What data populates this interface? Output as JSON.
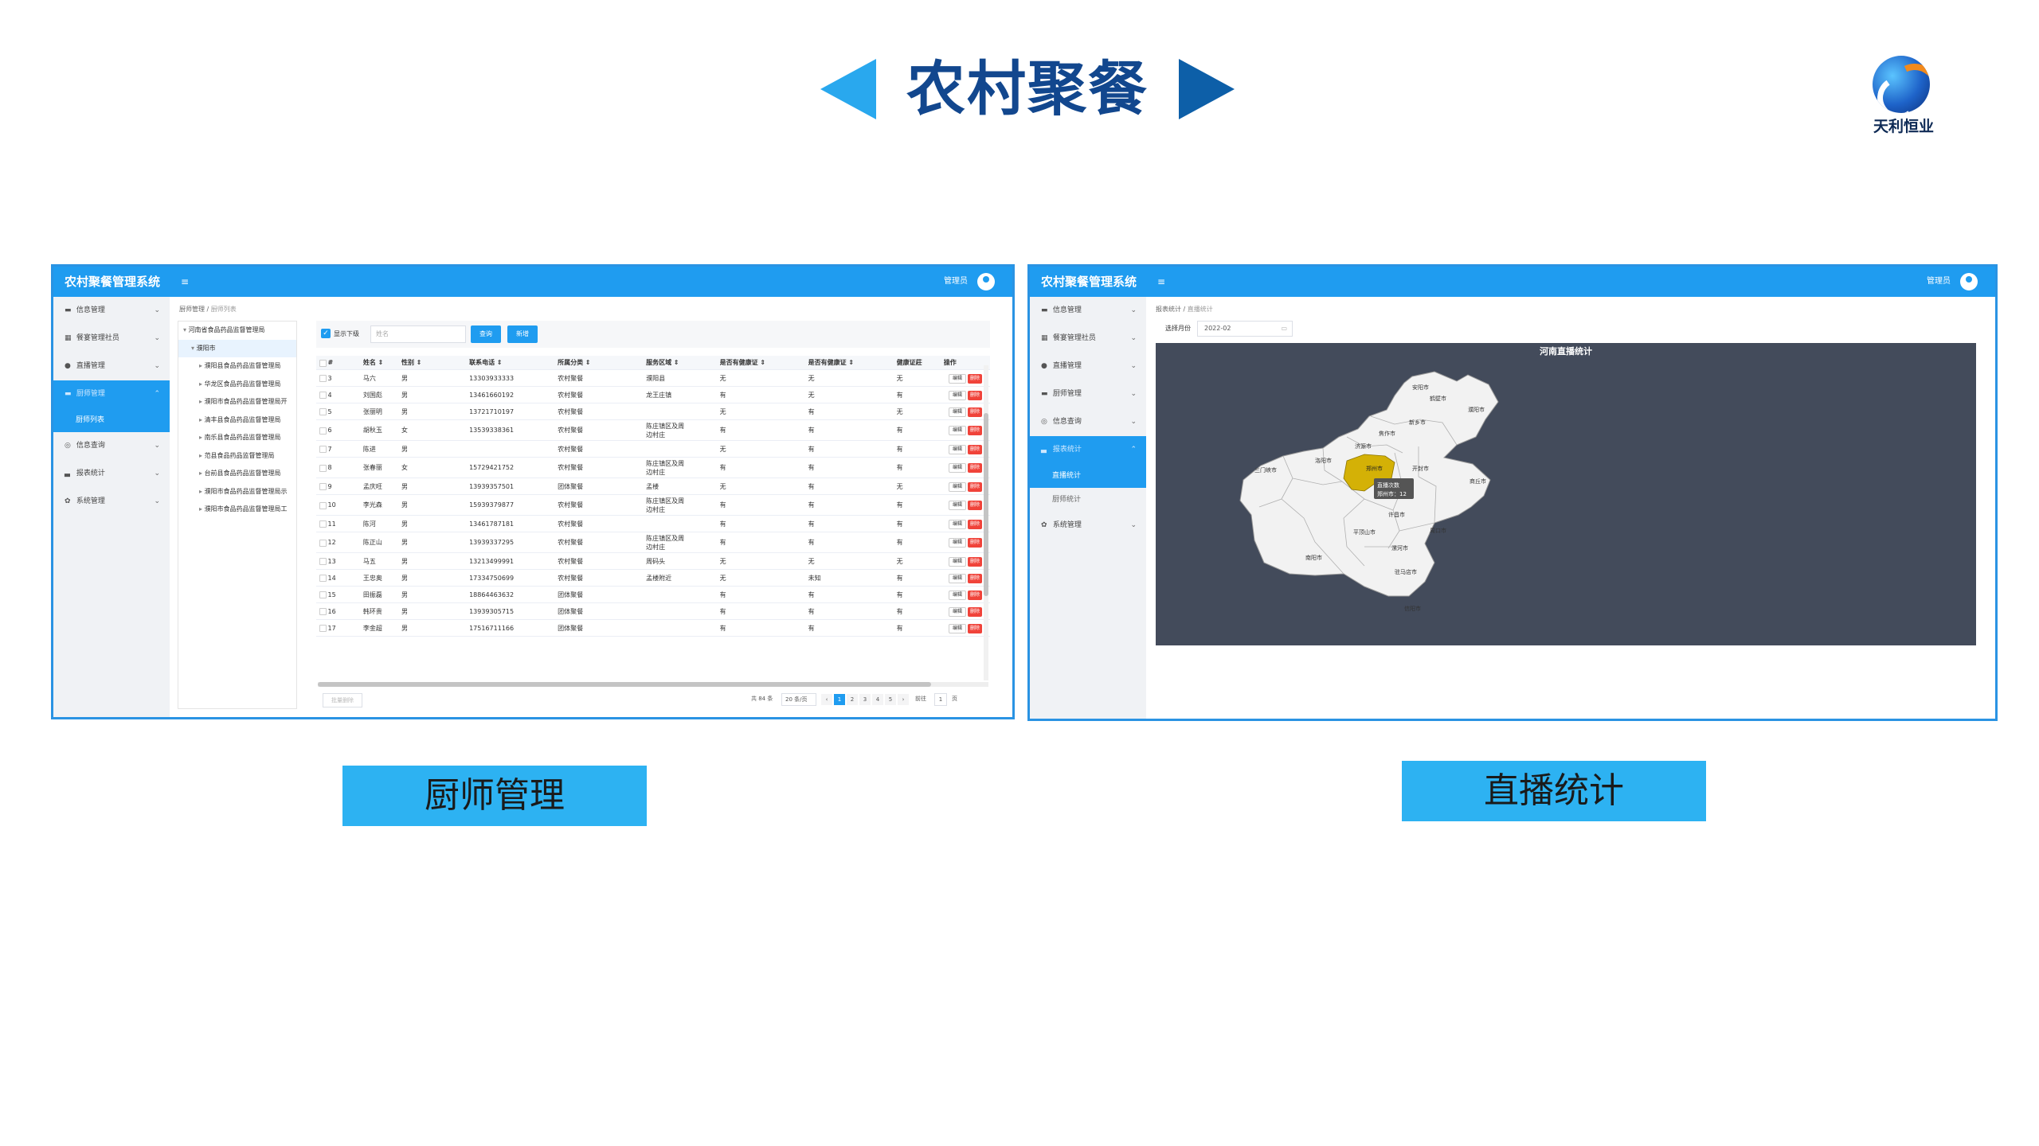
{
  "slide": {
    "title": "农村聚餐",
    "logo_text": "天利恒业",
    "caption_left": "厨师管理",
    "caption_right": "直播统计"
  },
  "screen1": {
    "system_title": "农村聚餐管理系统",
    "menu_icon": "≡",
    "admin_label": "管理员",
    "sidebar": [
      {
        "icon": "▬",
        "label": "信息管理"
      },
      {
        "icon": "▦",
        "label": "餐宴管理社员"
      },
      {
        "icon": "●",
        "label": "直播管理"
      },
      {
        "icon": "▬",
        "label": "厨师管理",
        "active": true
      },
      {
        "icon": "◎",
        "label": "信息查询"
      },
      {
        "icon": "▃",
        "label": "报表统计"
      },
      {
        "icon": "✿",
        "label": "系统管理"
      }
    ],
    "sidebar_sub": "厨师列表",
    "breadcrumb": [
      "厨师管理",
      "厨师列表"
    ],
    "tree": [
      "河南省食品药品监督管理局",
      "濮阳市",
      "濮阳县食品药品监督管理局",
      "华龙区食品药品监督管理局",
      "濮阳市食品药品监督管理局开",
      "清丰县食品药品监督管理局",
      "南乐县食品药品监督管理局",
      "范县食品药品监督管理局",
      "台前县食品药品监督管理局",
      "濮阳市食品药品监督管理局示",
      "濮阳市食品药品监督管理局工"
    ],
    "toolbar": {
      "show_sub_label": "显示下级",
      "search_placeholder": "姓名",
      "query_button": "查询",
      "add_button": "新增"
    },
    "columns": [
      "#",
      "姓名 ⇕",
      "性别 ⇕",
      "联系电话 ⇕",
      "所属分类 ⇕",
      "服务区域 ⇕",
      "是否有健康证 ⇕",
      "是否有健康证 ⇕",
      "健康证莊",
      "操作"
    ],
    "rows": [
      [
        "3",
        "马六",
        "男",
        "13303933333",
        "农村聚餐",
        "濮阳县",
        "无",
        "无",
        "无"
      ],
      [
        "4",
        "刘国彪",
        "男",
        "13461660192",
        "农村聚餐",
        "龙王庄镇",
        "有",
        "无",
        "有"
      ],
      [
        "5",
        "张丽明",
        "男",
        "13721710197",
        "农村聚餐",
        "",
        "无",
        "有",
        "无"
      ],
      [
        "6",
        "胡秋玉",
        "女",
        "13539338361",
        "农村聚餐",
        "陈庄镇区及周边村庄",
        "有",
        "有",
        "有"
      ],
      [
        "7",
        "陈进",
        "男",
        "",
        "农村聚餐",
        "",
        "无",
        "有",
        "有"
      ],
      [
        "8",
        "张春丽",
        "女",
        "15729421752",
        "农村聚餐",
        "陈庄镇区及周边村庄",
        "有",
        "有",
        "有"
      ],
      [
        "9",
        "孟庆旺",
        "男",
        "13939357501",
        "团体聚餐",
        "孟楼",
        "无",
        "有",
        "无"
      ],
      [
        "10",
        "李光森",
        "男",
        "15939379877",
        "农村聚餐",
        "陈庄镇区及周边村庄",
        "有",
        "有",
        "有"
      ],
      [
        "11",
        "陈河",
        "男",
        "13461787181",
        "农村聚餐",
        "",
        "有",
        "有",
        "有"
      ],
      [
        "12",
        "陈正山",
        "男",
        "13939337295",
        "农村聚餐",
        "陈庄镇区及周边村庄",
        "有",
        "有",
        "有"
      ],
      [
        "13",
        "马五",
        "男",
        "13213499991",
        "农村聚餐",
        "周码头",
        "无",
        "无",
        "无"
      ],
      [
        "14",
        "王忠奥",
        "男",
        "17334750699",
        "农村聚餐",
        "孟楼附近",
        "无",
        "未知",
        "有"
      ],
      [
        "15",
        "田振磊",
        "男",
        "18864463632",
        "团体聚餐",
        "",
        "有",
        "有",
        "有"
      ],
      [
        "16",
        "韩环贵",
        "男",
        "13939305715",
        "团体聚餐",
        "",
        "有",
        "有",
        "有"
      ],
      [
        "17",
        "李金超",
        "男",
        "17516711166",
        "团体聚餐",
        "",
        "有",
        "有",
        "有"
      ]
    ],
    "edit_label": "编辑",
    "delete_label": "删除",
    "bulk_delete": "批量删除",
    "pager": {
      "total": "共 84 条",
      "page_size": "20 条/页",
      "pages": [
        "1",
        "2",
        "3",
        "4",
        "5"
      ],
      "goto_label": "前往",
      "goto_value": "1",
      "goto_suffix": "页"
    }
  },
  "screen2": {
    "system_title": "农村聚餐管理系统",
    "menu_icon": "≡",
    "admin_label": "管理员",
    "sidebar": [
      {
        "icon": "▬",
        "label": "信息管理"
      },
      {
        "icon": "▦",
        "label": "餐宴管理社员"
      },
      {
        "icon": "●",
        "label": "直播管理"
      },
      {
        "icon": "▬",
        "label": "厨师管理"
      },
      {
        "icon": "◎",
        "label": "信息查询"
      },
      {
        "icon": "▃",
        "label": "报表统计",
        "active": true
      }
    ],
    "sidebar_sub": [
      "直播统计",
      "厨师统计"
    ],
    "sidebar_after": {
      "icon": "✿",
      "label": "系统管理"
    },
    "breadcrumb": [
      "报表统计",
      "直播统计"
    ],
    "month_label": "选择月份",
    "month_value": "2022-02",
    "chart": {
      "title": "河南直播统计",
      "highlight_city": "郑州市",
      "tooltip_line1": "直播次数",
      "tooltip_line2": "郑州市：12",
      "highlight_color": "#d4b106",
      "bg_color": "#434b5b",
      "cities": [
        "安阳市",
        "鹤壁市",
        "濮阳市",
        "新乡市",
        "焦作市",
        "济源市",
        "洛阳市",
        "郑州市",
        "开封市",
        "商丘市",
        "三门峡市",
        "平顶山市",
        "许昌市",
        "漯河市",
        "周口市",
        "南阳市",
        "驻马店市",
        "信阳市"
      ]
    }
  }
}
